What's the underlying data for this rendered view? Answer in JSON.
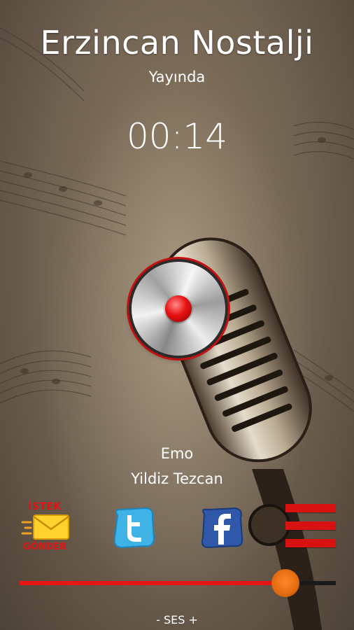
{
  "header": {
    "station_name": "Erzincan Nostalji",
    "status": "Yayında",
    "timer": "00:14"
  },
  "now_playing": {
    "artist": "Emo",
    "title": "Yildiz Tezcan"
  },
  "actions": {
    "request_top": "İSTEK",
    "request_bottom": "GÖNDER",
    "twitter_icon": "twitter-icon",
    "facebook_icon": "facebook-icon",
    "menu_icon": "menu-icon"
  },
  "volume": {
    "label": "- SES +",
    "level_percent": 84
  },
  "colors": {
    "accent_red": "#e21414",
    "slider_thumb": "#e46a10"
  }
}
